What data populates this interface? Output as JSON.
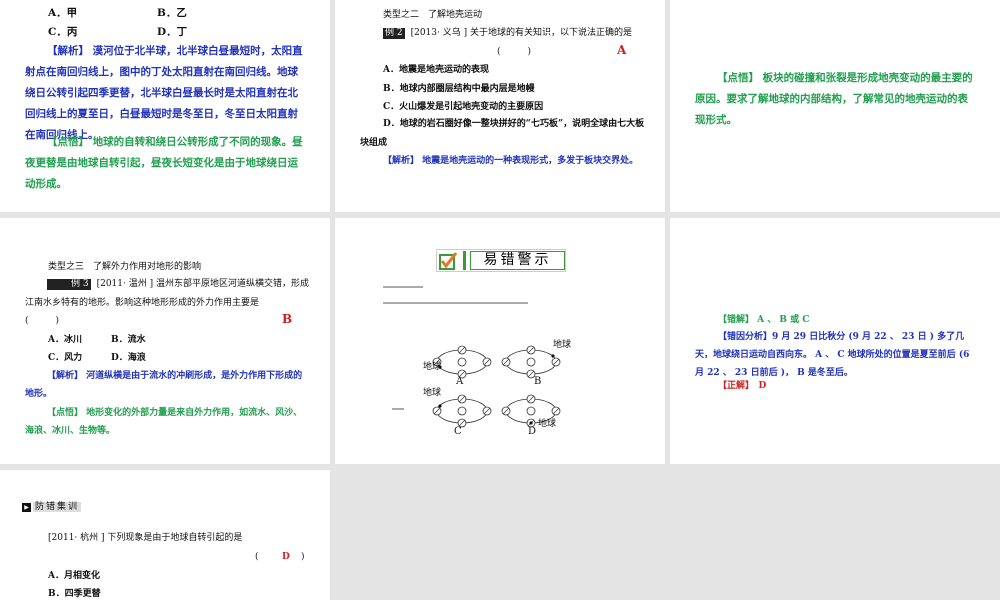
{
  "slides": [
    {
      "options": [
        "A．甲",
        "B．乙",
        "C．丙",
        "D．丁"
      ],
      "analysis_label": "【解析】",
      "analysis": "漠河位于北半球，北半球白昼最短时，太阳直射点在南回归线上，图中的丁处太阳直射在南回归线。地球绕日公转引起四季更替，北半球白昼最长时是太阳直射在北回归线上的夏至日，白昼最短时是冬至日，冬至日太阳直射在南回归线上。",
      "insight_label": "【点悟】",
      "insight": "地球的自转和绕日公转形成了不同的现象。昼夜更替是由地球自转引起，昼夜长短变化是由于地球绕日运动形成。"
    },
    {
      "type_title": "类型之二　了解地壳运动",
      "example_tag": "例 2",
      "question": "[2013· 义乌 ] 关于地球的有关知识，以下说法正确的是",
      "paren": "(　　　)",
      "answer": "A",
      "options": [
        "A．地震是地壳运动的表现",
        "B．地球内部圈层结构中最内层是地幔",
        "C．火山爆发是引起地壳变动的主要原因",
        "D．地球的岩石圈好像一整块拼好的“七巧板”，说明全球由七大板块组成"
      ],
      "analysis_label": "【解析】",
      "analysis": "地震是地壳运动的一种表现形式，多发于板块交界处。"
    },
    {
      "insight_label": "【点悟】",
      "insight": "板块的碰撞和张裂是形成地壳变动的最主要的原因。要求了解地球的内部结构，了解常见的地壳运动的表现形式。"
    },
    {
      "type_title": "类型之三　了解外力作用对地形的影响",
      "example_tag": "例 3",
      "question": "[2011· 温州 ] 温州东部平原地区河道纵横交错，形成江南水乡特有的地形。影响这种地形形成的外力作用主要是",
      "paren": "(　　　)",
      "answer": "B",
      "options": [
        "A．冰川",
        "B．流水",
        "C．风力",
        "D．海浪"
      ],
      "analysis_label": "【解析】",
      "analysis": "河道纵横是由于流水的冲刷形成，是外力作用下形成的地形。",
      "insight_label": "【点悟】",
      "insight": "地形变化的外部力量是来自外力作用，如流水、风沙、海浪、冰川、生物等。"
    },
    {
      "banner": "易错警示",
      "diagram_labels": [
        "A",
        "B",
        "C",
        "D"
      ],
      "earth_label": "地球"
    },
    {
      "wrong_label": "【错解】",
      "wrong": "A 、 B 或 C",
      "reason_label": "【错因分析】",
      "reason": "9 月 29 日比秋分 (9 月 22 、 23 日 ) 多了几天，地球绕日运动自西向东。 A 、 C 地球所处的位置是夏至前后 (6 月 22 、 23 日前后 )， B 是冬至后。",
      "correct_label": "【正解】",
      "correct": "D"
    },
    {
      "section": "防错集训",
      "question": "[2011· 杭州 ] 下列现象是由于地球自转引起的是",
      "paren_open": "(",
      "answer": "D",
      "paren_close": ")",
      "options": [
        "A．月相变化",
        "B．四季更替"
      ]
    }
  ]
}
